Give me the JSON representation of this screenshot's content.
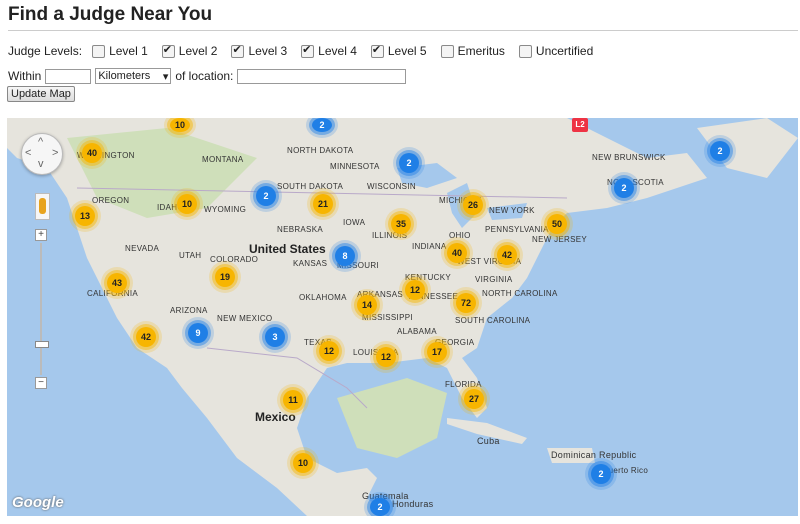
{
  "page": {
    "title": "Find a Judge Near You"
  },
  "filters": {
    "label": "Judge Levels:",
    "levels": [
      {
        "label": "Level 1",
        "checked": false
      },
      {
        "label": "Level 2",
        "checked": true
      },
      {
        "label": "Level 3",
        "checked": true
      },
      {
        "label": "Level 4",
        "checked": true
      },
      {
        "label": "Level 5",
        "checked": true
      },
      {
        "label": "Emeritus",
        "checked": false
      },
      {
        "label": "Uncertified",
        "checked": false
      }
    ]
  },
  "distance": {
    "within_label": "Within",
    "radius_value": "",
    "unit_selected": "Kilometers",
    "of_location_label": "of location:",
    "location_value": ""
  },
  "update_button": "Update Map",
  "map": {
    "colors": {
      "water": "#a5c8ec",
      "land": "#e6e4dd",
      "green": "#c8dcb0",
      "cluster_yellow": "#f7b500",
      "cluster_blue": "#1f7fe6"
    },
    "country_labels": [
      "United States",
      "Mexico",
      "Cuba",
      "Dominican Republic",
      "Guatemala",
      "Honduras"
    ],
    "state_labels": [
      "WASHINGTON",
      "MONTANA",
      "NORTH DAKOTA",
      "MINNESOTA",
      "SOUTH DAKOTA",
      "OREGON",
      "IDAHO",
      "WYOMING",
      "WISCONSIN",
      "MICHIGAN",
      "IOWA",
      "NEBRASKA",
      "NEVADA",
      "UTAH",
      "COLORADO",
      "KANSAS",
      "MISSOURI",
      "ILLINOIS",
      "INDIANA",
      "OHIO",
      "PENNSYLVANIA",
      "NEW YORK",
      "NEW JERSEY",
      "KENTUCKY",
      "VIRGINIA",
      "WEST VIRGINIA",
      "CALIFORNIA",
      "ARIZONA",
      "NEW MEXICO",
      "OKLAHOMA",
      "ARKANSAS",
      "TENNESSEE",
      "NORTH CAROLINA",
      "SOUTH CAROLINA",
      "MISSISSIPPI",
      "ALABAMA",
      "GEORGIA",
      "TEXAS",
      "LOUISIANA",
      "FLORIDA",
      "NEW BRUNSWICK",
      "NOVA SCOTIA",
      "Puerto Rico"
    ],
    "marker_label": "L2",
    "attribution": "Google",
    "clusters": [
      {
        "count": "10",
        "color": "yellow"
      },
      {
        "count": "2",
        "color": "blue"
      },
      {
        "count": "40",
        "color": "yellow"
      },
      {
        "count": "2",
        "color": "blue"
      },
      {
        "count": "2",
        "color": "blue"
      },
      {
        "count": "2",
        "color": "blue"
      },
      {
        "count": "2",
        "color": "blue"
      },
      {
        "count": "10",
        "color": "yellow"
      },
      {
        "count": "21",
        "color": "yellow"
      },
      {
        "count": "26",
        "color": "yellow"
      },
      {
        "count": "13",
        "color": "yellow"
      },
      {
        "count": "35",
        "color": "yellow"
      },
      {
        "count": "50",
        "color": "yellow"
      },
      {
        "count": "8",
        "color": "blue"
      },
      {
        "count": "40",
        "color": "yellow"
      },
      {
        "count": "42",
        "color": "yellow"
      },
      {
        "count": "19",
        "color": "yellow"
      },
      {
        "count": "43",
        "color": "yellow"
      },
      {
        "count": "12",
        "color": "yellow"
      },
      {
        "count": "14",
        "color": "yellow"
      },
      {
        "count": "72",
        "color": "yellow"
      },
      {
        "count": "9",
        "color": "blue"
      },
      {
        "count": "42",
        "color": "yellow"
      },
      {
        "count": "3",
        "color": "blue"
      },
      {
        "count": "12",
        "color": "yellow"
      },
      {
        "count": "12",
        "color": "yellow"
      },
      {
        "count": "17",
        "color": "yellow"
      },
      {
        "count": "11",
        "color": "yellow"
      },
      {
        "count": "27",
        "color": "yellow"
      },
      {
        "count": "10",
        "color": "yellow"
      },
      {
        "count": "2",
        "color": "blue"
      },
      {
        "count": "2",
        "color": "blue"
      }
    ]
  }
}
